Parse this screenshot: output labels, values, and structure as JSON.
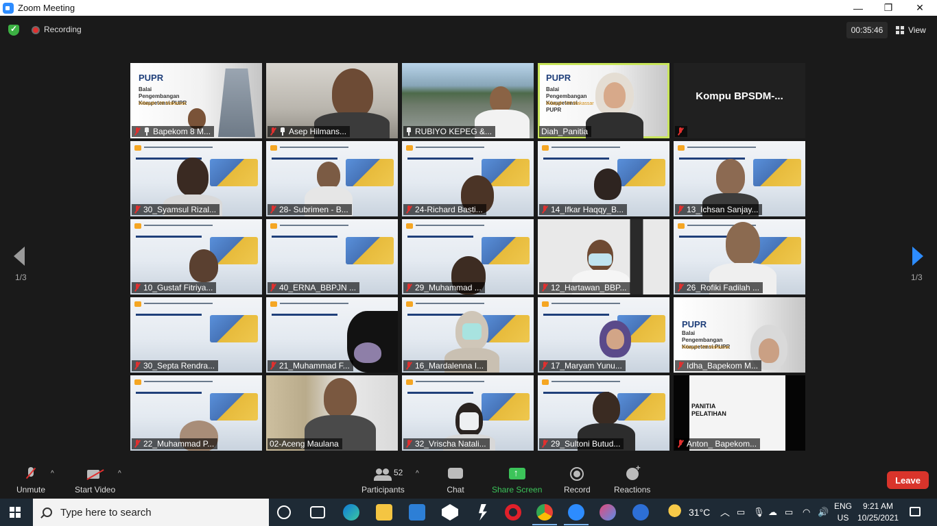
{
  "window": {
    "title": "Zoom Meeting",
    "controls": [
      "—",
      "❐",
      "✕"
    ]
  },
  "topbar": {
    "recording_label": "Recording",
    "timer": "00:35:46",
    "view_label": "View"
  },
  "pagination": {
    "left_page": "1/3",
    "right_page": "1/3"
  },
  "participants": [
    "Bapekom 8 M...",
    "Asep Hilmans...",
    "RUBIYO KEPEG &...",
    "Diah_Panitia",
    "Kompu  BPSDM-...",
    "30_Syamsul Rizal...",
    "28- Subrimen - B...",
    "24-Richard Basti...",
    "14_Ifkar Haqqy_B...",
    "13_Ichsan Sanjay...",
    "10_Gustaf Fitriya...",
    "40_ERNA_BBPJN ...",
    "29_Muhammad ...",
    "12_Hartawan_BBP...",
    "26_Rofiki Fadilah ...",
    "30_Septa Rendra...",
    "21_Muhammad F...",
    "16_Mardalenna I...",
    "17_Maryam Yunu...",
    "Idha_Bapekom M...",
    "22_Muhammad P...",
    "02-Aceng Maulana",
    "32_Vrischa Natali...",
    "29_Sultoni Butud...",
    "Anton_ Bapekom..."
  ],
  "name_only_tile": "Kompu  BPSDM-...",
  "slide": {
    "pupr_logo": "PUPR",
    "balai_text": "Balai Pengembangan Kompetensi PUPR",
    "wilayah_text": "Wilayah VIII Makassar",
    "panitia_text": "PANITIA PELATIHAN"
  },
  "toolbar": {
    "unmute": "Unmute",
    "start_video": "Start Video",
    "participants_count": "52",
    "participants": "Participants",
    "chat": "Chat",
    "share_screen": "Share Screen",
    "record": "Record",
    "reactions": "Reactions",
    "leave": "Leave",
    "caret": "^"
  },
  "taskbar": {
    "search_placeholder": "Type here to search",
    "weather_temp": "31°C",
    "lang_top": "ENG",
    "lang_bottom": "US",
    "time": "9:21 AM",
    "date": "10/25/2021"
  },
  "colors": {
    "accent": "#2d8cff",
    "record_red": "#e0302f",
    "share_green": "#3cc45a",
    "leave_red": "#d9342b",
    "active_speaker": "#c8e55a"
  }
}
